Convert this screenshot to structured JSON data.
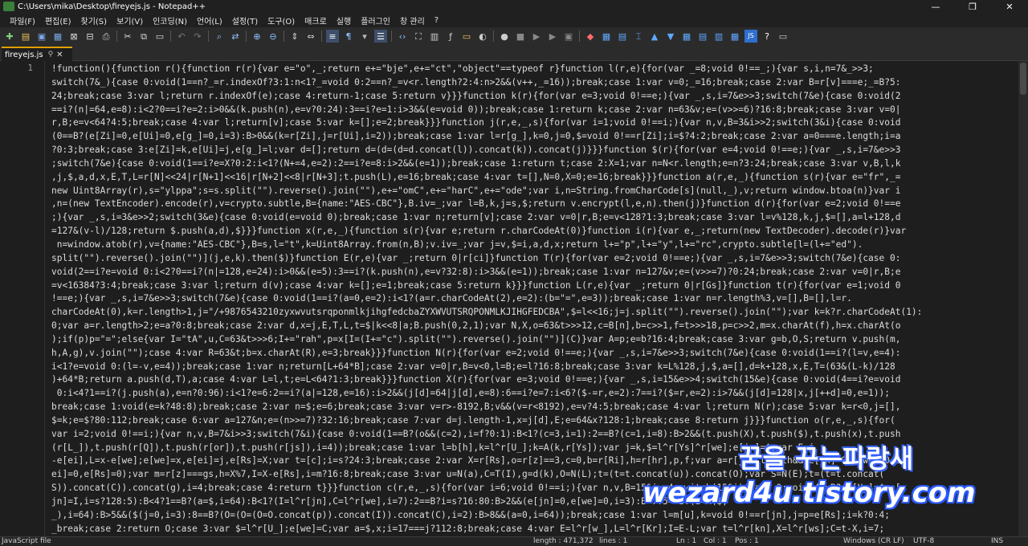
{
  "window": {
    "title": "C:\\Users\\mika\\Desktop\\fireyejs.js - Notepad++",
    "minimize": "—",
    "maximize": "❐",
    "close": "✕"
  },
  "menu": [
    "파일(F)",
    "편집(E)",
    "찾기(S)",
    "보기(V)",
    "인코딩(N)",
    "언어(L)",
    "설정(T)",
    "도구(O)",
    "매크로",
    "실행",
    "플러그인",
    "창 관리",
    "?"
  ],
  "tab": {
    "label": "fireyejs.js"
  },
  "editor": {
    "line_number": "1",
    "lines": [
      "!function(){function r(){function r(r){var e=\"o\",_;return e+=\"bje\",e+=\"ct\",\"object\"==typeof r}function l(r,e){for(var _=8;void 0!==_;){var s,i,n=7&_>>3;",
      "switch(7&_){case 0:void(1==n?_=r.indexOf?3:1:n<1?_=void 0:2==n?_=v<r.length?2:4:n>2&&(v++,_=16));break;case 1:var v=0;_=16;break;case 2:var B=r[v]===e;_=B?5:",
      "24;break;case 3:var l;return r.indexOf(e);case 4:return-1;case 5:return v}}}function k(r){for(var e=3;void 0!==e;){var _,s,i=7&e>>3;switch(7&e){case 0:void(2",
      "==i?(n|=64,e=8):i<2?0==i?e=2:i>0&&(k.push(n),e=v?0:24):3==i?e=1:i>3&&(e=void 0));break;case 1:return k;case 2:var n=63&v;e=(v>>=6)?16:8;break;case 3:var v=0|",
      "r,B;e=v<64?4:5;break;case 4:var l;return[v];case 5:var k=[];e=2;break}}}function j(r,e,_,s){for(var i=1;void 0!==i;){var n,v,B=3&i>>2;switch(3&i){case 0:void",
      "(0==B?(e[Zi]=0,e[Ui]=0,e[g_]=0,i=3):B>0&&(k=r[Zi],j=r[Ui],i=2));break;case 1:var l=r[g_],k=0,j=0,$=void 0!==r[Zi];i=$?4:2;break;case 2:var a=0===e.length;i=a",
      "?0:3;break;case 3:e[Zi]=k,e[Ui]=j,e[g_]=l;var d=[];return d=(d=(d=d.concat(l)).concat(k)).concat(j)}}}function $(r){for(var e=4;void 0!==e;){var _,s,i=7&e>>3",
      ";switch(7&e){case 0:void(1==i?e=X?0:2:i<1?(N+=4,e=2):2==i?e=8:i>2&&(e=1));break;case 1:return t;case 2:X=1;var n=N<r.length;e=n?3:24;break;case 3:var v,B,l,k",
      ",j,$,a,d,x,E,T,L=r[N]<<24|r[N+1]<<16|r[N+2]<<8|r[N+3];t.push(L),e=16;break;case 4:var t=[],N=0,X=0;e=16;break}}}function a(r,e,_){function s(r){var e=\"fr\",_=",
      "new Uint8Array(r),s=\"ylppa\";s=s.split(\"\").reverse().join(\"\"),e+=\"omC\",e+=\"harC\",e+=\"ode\";var i,n=String.fromCharCode[s](null,_),v;return window.btoa(n)}var i",
      ",n=(new TextEncoder).encode(r),v=crypto.subtle,B={name:\"AES-CBC\"},B.iv=_;var l=B,k,j=s,$;return v.encrypt(l,e,n).then(j)}function d(r){for(var e=2;void 0!==e",
      ";){var _,s,i=3&e>>2;switch(3&e){case 0:void(e=void 0);break;case 1:var n;return[v];case 2:var v=0|r,B;e=v<128?1:3;break;case 3:var l=v%128,k,j,$=[],a=l+128,d",
      "=127&(v-l)/128;return $.push(a,d),$}}}function x(r,e,_){function s(r){var e;return r.charCodeAt(0)}function i(r){var e,_;return(new TextDecoder).decode(r)}var",
      " n=window.atob(r),v={name:\"AES-CBC\"},B=s,l=\"t\",k=Uint8Array.from(n,B);v.iv=_;var j=v,$=i,a,d,x;return l+=\"p\",l+=\"y\",l+=\"rc\",crypto.subtle[l=(l+=\"ed\").",
      "split(\"\").reverse().join(\"\")](j,e,k).then($)}function E(r,e){var _;return 0|r[ci]}function T(r){for(var e=2;void 0!==e;){var _,s,i=7&e>>3;switch(7&e){case 0:",
      "void(2==i?e=void 0:i<2?0==i?(n|=128,e=24):i>0&&(e=5):3==i?(k.push(n),e=v?32:8):i>3&&(e=1));break;case 1:var n=127&v;e=(v>>=7)?0:24;break;case 2:var v=0|r,B;e",
      "=v<16384?3:4;break;case 3:var l;return d(v);case 4:var k=[];e=1;break;case 5:return k}}}function L(r,e){var _;return 0|r[Gs]}function t(r){for(var e=1;void 0",
      "!==e;){var _,s,i=7&e>>3;switch(7&e){case 0:void(1==i?(a=0,e=2):i<1?(a=r.charCodeAt(2),e=2):(b=\"=\",e=3));break;case 1:var n=r.length%3,v=[],B=[],l=r.",
      "charCodeAt(0),k=r.length>1,j=\"/+9876543210zyxwvutsrqponmlkjihgfedcbaZYXWVUTSRQPONMLKJIHGFEDCBA\",$=l<<16;j=j.split(\"\").reverse().join(\"\");var k=k?r.charCodeAt(1):",
      "0;var a=r.length>2;e=a?0:8;break;case 2:var d,x=j,E,T,L,t=$|k<<8|a;B.push(0,2,1);var N,X,o=63&t>>>12,c=B[n],b=c>>1,f=t>>>18,p=c>>2,m=x.charAt(f),h=x.charAt(o",
      ");if(p)p=\"=\";else{var I=\"tA\",u,C=63&t>>>6;I+=\"rah\",p=x[I=(I+=\"c\").split(\"\").reverse().join(\"\")](C)}var A=p;e=b?16:4;break;case 3:var g=b,O,S;return v.push(m,",
      "h,A,g),v.join(\"\");case 4:var R=63&t;b=x.charAt(R),e=3;break}}}function N(r){for(var e=2;void 0!==e;){var _,s,i=7&e>>3;switch(7&e){case 0:void(1==i?(l=v,e=4):",
      "i<1?e=void 0:(l=-v,e=4));break;case 1:var n;return[L+64*B];case 2:var v=0|r,B=v<0,l=B;e=l?16:8;break;case 3:var k=L%128,j,$,a=[],d=k+128,x,E,T=(63&(L-k)/128",
      ")+64*B;return a.push(d,T),a;case 4:var L=l,t;e=L<64?1:3;break}}}function X(r){for(var e=3;void 0!==e;){var _,s,i=15&e>>4;switch(15&e){case 0:void(4==i?e=void",
      " 0:i<4?1==i?(j.push(a),e=n?0:96):i<1?e=6:2==i?(a|=128,e=16):i>2&&(j[d]=64|j[d],e=8):6==i?e=7:i<6?($-=r,e=2):7==i?($=r,e=2):i>7&&(j[d]=128|x,j[++d]=0,e=1));",
      "break;case 1:void(e=k?48:8);break;case 2:var n=$;e=6;break;case 3:var v=r>-8192,B;v&&(v=r<8192),e=v?4:5;break;case 4:var l;return N(r);case 5:var k=r<0,j=[],",
      "$=k;e=$?80:112;break;case 6:var a=127&n;e=(n>>=7)?32:16;break;case 7:var d=j.length-1,x=j[d],E;e=64&x?128:1;break;case 8:return j}}}function o(r,e,_,s){for(",
      "var i=2;void 0!==i;){var n,v,B=7&i>>3;switch(7&i){case 0:void(1==B?(o&&(c=2),i=f?0:1):B<1?(c=3,i=1):2==B?(c=1,i=8):B>2&&(t.push(X),t.push($),t.push(x),t.push",
      "(r[L_]),t.push(r[Q]),t.push(r[or]),t.push(r[js]),i=4));break;case 1:var l=b[h],k=l^r[U_];k=A(k,r[Ys]);var j=k,$=l^r[Ys]^r[we];e[jn]=$;var E=j",
      "-e[ei],L=x-e[we];e[we]=x,e[ei]=j,e[Rs]=X;var t=[c];i=s?24:3;break;case 2:var X=r[Rs],o=r[z]==3,c=0,b=r[Ri],h=r[hr],p,f;var a=r[jn].length&&(e[jn]=0,e[we]=0,e[",
      "ei]=0,e[Rs]=0);var m=r[z]===gs,h=X%7,I=X-e[Rs],i=m?16:8;break;case 3:var u=N(a),C=T(I),g=d(k),O=N(L);t=(t=t.concat(u)).concat(O);var S=N(E);t=(t=t.concat(",
      "S)).concat(C)).concat(g),i=4;break;case 4:return t}}}function c(r,e,_,s){for(var i=6;void 0!==i;){var n,v,B=15&i>>4;switch(15&i){case 0:void(4==B?(e[U_]=$,e[",
      "jn]=I,i=s?128:5):B<4?1==B?(a=$,i=64):B<1?(I=l^r[jn],C=l^r[we],i=7):2==B?i=s?16:80:B>2&&(e[jn]=0,e[we]=0,i=3):B<7?5==B?(a=A($,",
      "_),i=64):B>5&&($(j=0,i=3):8==B?(O=(O=(O=O.concat(p)).concat(I)).concat(C),i=2):B>8&&(a=0,i=64));break;case 1:var l=m[u],k=void 0!==r[jn],j=p=e[Rs];i=k?0:4;",
      "_break;case 2:return O;case 3:var $=l^r[U_];e[we]=C;var a=$,x;i=17===j?112:8;break;case 4:var E=l^r[w_],L=l^r[Kr];I=E-L;var t=l^r[kn],X=l^r[ws];C=t-X,i=7;"
    ]
  },
  "watermark": {
    "line1": "꿈을 꾸는파랑새",
    "line2": "wezard4u.tistory.com"
  },
  "status": {
    "file_type": "JavaScript file",
    "length": "length : 471,372",
    "lines": "lines : 1",
    "ln": "Ln : 1",
    "col": "Col : 1",
    "pos": "Pos : 1",
    "eol": "Windows (CR LF)",
    "encoding": "UTF-8",
    "mode": "INS"
  }
}
